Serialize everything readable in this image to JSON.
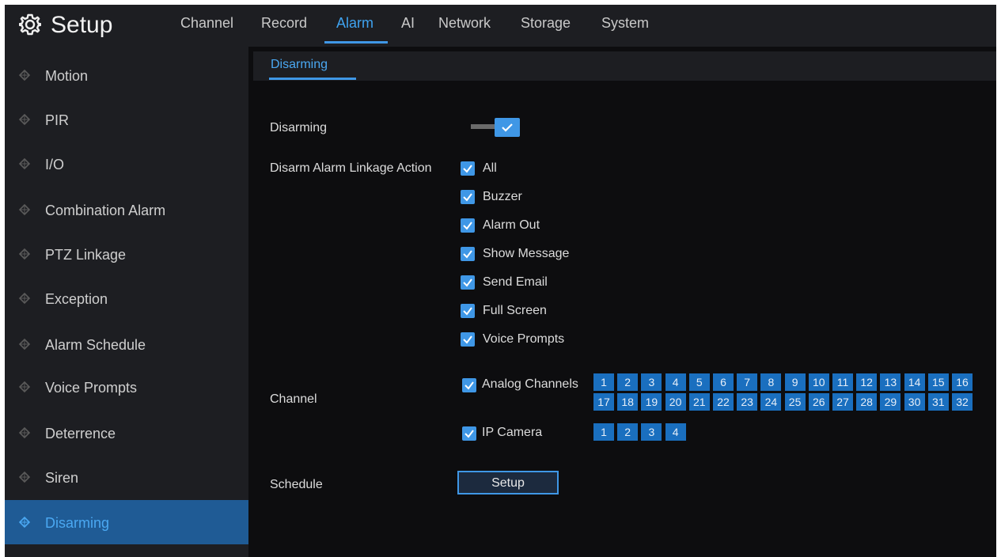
{
  "header": {
    "title": "Setup",
    "tabs": [
      {
        "label": "Channel",
        "active": false
      },
      {
        "label": "Record",
        "active": false
      },
      {
        "label": "Alarm",
        "active": true
      },
      {
        "label": "AI",
        "active": false
      },
      {
        "label": "Network",
        "active": false
      },
      {
        "label": "Storage",
        "active": false
      },
      {
        "label": "System",
        "active": false
      }
    ]
  },
  "sidebar": {
    "items": [
      {
        "label": "Motion",
        "active": false
      },
      {
        "label": "PIR",
        "active": false
      },
      {
        "label": "I/O",
        "active": false
      },
      {
        "label": "Combination Alarm",
        "active": false
      },
      {
        "label": "PTZ Linkage",
        "active": false
      },
      {
        "label": "Exception",
        "active": false
      },
      {
        "label": "Alarm Schedule",
        "active": false
      },
      {
        "label": "Voice Prompts",
        "active": false
      },
      {
        "label": "Deterrence",
        "active": false
      },
      {
        "label": "Siren",
        "active": false
      },
      {
        "label": "Disarming",
        "active": true
      }
    ]
  },
  "subtab": {
    "label": "Disarming"
  },
  "form": {
    "disarming_label": "Disarming",
    "disarming_enabled": true,
    "linkage_label": "Disarm Alarm Linkage Action",
    "linkage_options": [
      {
        "label": "All",
        "checked": true
      },
      {
        "label": "Buzzer",
        "checked": true
      },
      {
        "label": "Alarm Out",
        "checked": true
      },
      {
        "label": "Show Message",
        "checked": true
      },
      {
        "label": "Send Email",
        "checked": true
      },
      {
        "label": "Full Screen",
        "checked": true
      },
      {
        "label": "Voice Prompts",
        "checked": true
      }
    ],
    "channel_label": "Channel",
    "analog_label": "Analog Channels",
    "analog_checked": true,
    "analog_channels": [
      "1",
      "2",
      "3",
      "4",
      "5",
      "6",
      "7",
      "8",
      "9",
      "10",
      "11",
      "12",
      "13",
      "14",
      "15",
      "16",
      "17",
      "18",
      "19",
      "20",
      "21",
      "22",
      "23",
      "24",
      "25",
      "26",
      "27",
      "28",
      "29",
      "30",
      "31",
      "32"
    ],
    "ip_label": "IP Camera",
    "ip_checked": true,
    "ip_channels": [
      "1",
      "2",
      "3",
      "4"
    ],
    "schedule_label": "Schedule",
    "schedule_button": "Setup"
  },
  "colors": {
    "accent": "#3f97e6",
    "active_sidebar_bg": "#1f5b95",
    "background": "#0d0d0f",
    "panel": "#1d1e22"
  }
}
